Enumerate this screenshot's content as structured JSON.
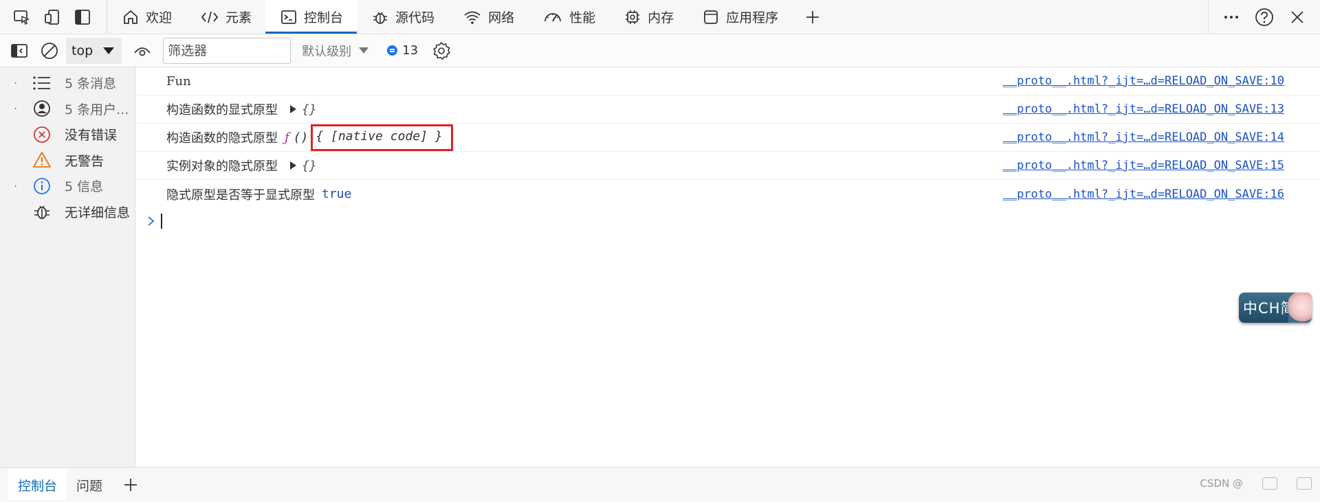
{
  "tabbar": {
    "tabs": [
      {
        "label": "欢迎",
        "icon": "home-icon",
        "active": false
      },
      {
        "label": "元素",
        "icon": "code-icon",
        "active": false
      },
      {
        "label": "控制台",
        "icon": "console-icon",
        "active": true
      },
      {
        "label": "源代码",
        "icon": "bug-icon",
        "active": false
      },
      {
        "label": "网络",
        "icon": "wifi-icon",
        "active": false
      },
      {
        "label": "性能",
        "icon": "gauge-icon",
        "active": false
      },
      {
        "label": "内存",
        "icon": "chip-icon",
        "active": false
      },
      {
        "label": "应用程序",
        "icon": "window-icon",
        "active": false
      }
    ],
    "accent_color": "#0f6cbd"
  },
  "console_toolbar": {
    "context": "top",
    "filter_placeholder": "筛选器",
    "level_label": "默认级别",
    "message_count": "13"
  },
  "sidebar": {
    "items": [
      {
        "label": "5 条消息",
        "icon": "list-icon",
        "expandable": true
      },
      {
        "label": "5 条用户...",
        "icon": "user-icon",
        "expandable": true
      },
      {
        "label": "没有错误",
        "icon": "error-icon",
        "expandable": false
      },
      {
        "label": "无警告",
        "icon": "warning-icon",
        "expandable": false
      },
      {
        "label": "5 信息",
        "icon": "info-icon",
        "expandable": true
      },
      {
        "label": "无详细信息",
        "icon": "bug-icon",
        "expandable": false
      }
    ]
  },
  "console": {
    "rows": [
      {
        "text": "Fun",
        "source": "__proto__.html?_ijt=…d=RELOAD_ON_SAVE:10"
      },
      {
        "text": "构造函数的显式原型",
        "object": "{}",
        "source": "__proto__.html?_ijt=…d=RELOAD_ON_SAVE:13"
      },
      {
        "text": "构造函数的隐式原型",
        "fn_keyword": "ƒ",
        "fn_signature": "()",
        "native": "{ [native code] }",
        "source": "__proto__.html?_ijt=…d=RELOAD_ON_SAVE:14"
      },
      {
        "text": "实例对象的隐式原型",
        "object": "{}",
        "source": "__proto__.html?_ijt=…d=RELOAD_ON_SAVE:15"
      },
      {
        "text": "隐式原型是否等于显式原型",
        "value": "true",
        "source": "__proto__.html?_ijt=…d=RELOAD_ON_SAVE:16"
      }
    ],
    "highlight_color": "#e0202a"
  },
  "ime": {
    "label": "中CH简"
  },
  "drawer": {
    "tabs": [
      {
        "label": "控制台",
        "active": true
      },
      {
        "label": "问题",
        "active": false
      }
    ],
    "watermark": "CSDN @"
  }
}
